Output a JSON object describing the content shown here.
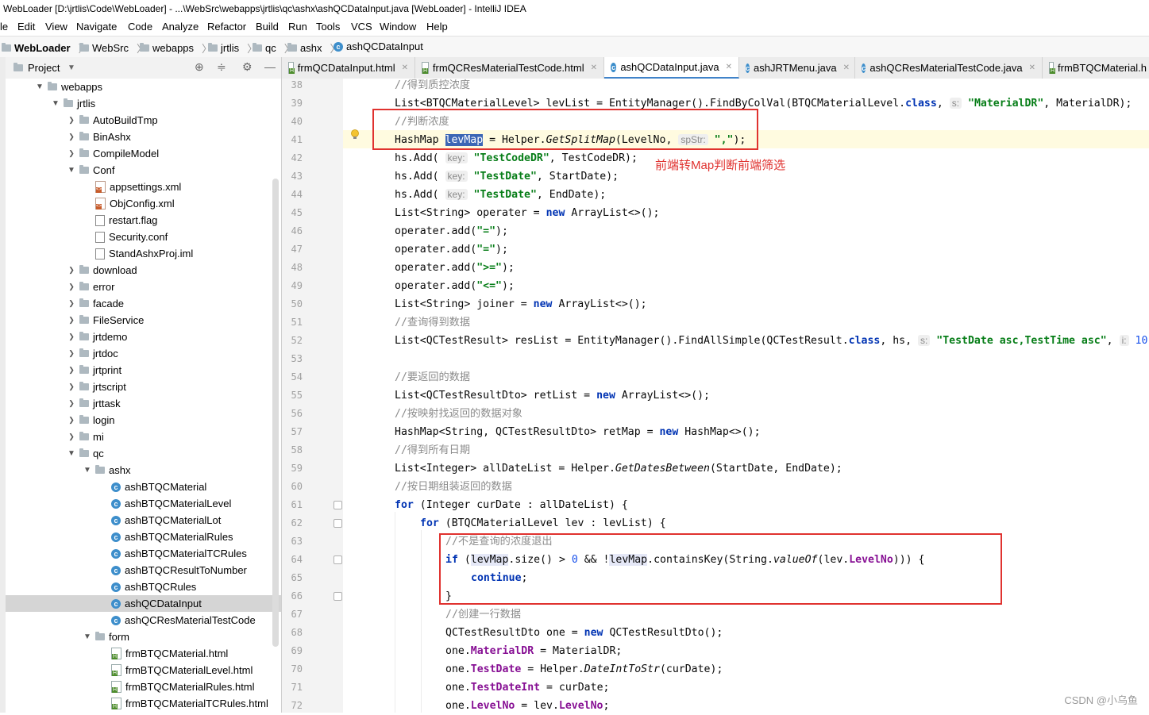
{
  "window": {
    "title": "WebLoader [D:\\jrtlis\\Code\\WebLoader] - ...\\WebSrc\\webapps\\jrtlis\\qc\\ashx\\ashQCDataInput.java [WebLoader] - IntelliJ IDEA"
  },
  "menu": [
    "le",
    "Edit",
    "View",
    "Navigate",
    "Code",
    "Analyze",
    "Refactor",
    "Build",
    "Run",
    "Tools",
    "VCS",
    "Window",
    "Help"
  ],
  "breadcrumb": [
    "WebLoader",
    "WebSrc",
    "webapps",
    "jrtlis",
    "qc",
    "ashx",
    "ashQCDataInput"
  ],
  "project_panel": {
    "title": "Project"
  },
  "tree": [
    {
      "label": "webapps",
      "kind": "folder",
      "depth": 2,
      "expanded": true
    },
    {
      "label": "jrtlis",
      "kind": "folder",
      "depth": 3,
      "expanded": true
    },
    {
      "label": "AutoBuildTmp",
      "kind": "folder",
      "depth": 4
    },
    {
      "label": "BinAshx",
      "kind": "folder",
      "depth": 4
    },
    {
      "label": "CompileModel",
      "kind": "folder",
      "depth": 4
    },
    {
      "label": "Conf",
      "kind": "folder",
      "depth": 4,
      "expanded": true
    },
    {
      "label": "appsettings.xml",
      "kind": "xml",
      "depth": 5
    },
    {
      "label": "ObjConfig.xml",
      "kind": "xml",
      "depth": 5
    },
    {
      "label": "restart.flag",
      "kind": "file",
      "depth": 5
    },
    {
      "label": "Security.conf",
      "kind": "file",
      "depth": 5
    },
    {
      "label": "StandAshxProj.iml",
      "kind": "file",
      "depth": 5
    },
    {
      "label": "download",
      "kind": "folder",
      "depth": 4
    },
    {
      "label": "error",
      "kind": "folder",
      "depth": 4
    },
    {
      "label": "facade",
      "kind": "folder",
      "depth": 4
    },
    {
      "label": "FileService",
      "kind": "folder",
      "depth": 4
    },
    {
      "label": "jrtdemo",
      "kind": "folder",
      "depth": 4
    },
    {
      "label": "jrtdoc",
      "kind": "folder",
      "depth": 4
    },
    {
      "label": "jrtprint",
      "kind": "folder",
      "depth": 4
    },
    {
      "label": "jrtscript",
      "kind": "folder",
      "depth": 4
    },
    {
      "label": "jrttask",
      "kind": "folder",
      "depth": 4
    },
    {
      "label": "login",
      "kind": "folder",
      "depth": 4
    },
    {
      "label": "mi",
      "kind": "folder",
      "depth": 4
    },
    {
      "label": "qc",
      "kind": "folder",
      "depth": 4,
      "expanded": true
    },
    {
      "label": "ashx",
      "kind": "folder",
      "depth": 5,
      "expanded": true
    },
    {
      "label": "ashBTQCMaterial",
      "kind": "class",
      "depth": 6
    },
    {
      "label": "ashBTQCMaterialLevel",
      "kind": "class",
      "depth": 6
    },
    {
      "label": "ashBTQCMaterialLot",
      "kind": "class",
      "depth": 6
    },
    {
      "label": "ashBTQCMaterialRules",
      "kind": "class",
      "depth": 6
    },
    {
      "label": "ashBTQCMaterialTCRules",
      "kind": "class",
      "depth": 6
    },
    {
      "label": "ashBTQCResultToNumber",
      "kind": "class",
      "depth": 6
    },
    {
      "label": "ashBTQCRules",
      "kind": "class",
      "depth": 6
    },
    {
      "label": "ashQCDataInput",
      "kind": "class",
      "depth": 6,
      "selected": true
    },
    {
      "label": "ashQCResMaterialTestCode",
      "kind": "class",
      "depth": 6
    },
    {
      "label": "form",
      "kind": "folder",
      "depth": 5,
      "expanded": true
    },
    {
      "label": "frmBTQCMaterial.html",
      "kind": "html",
      "depth": 6
    },
    {
      "label": "frmBTQCMaterialLevel.html",
      "kind": "html",
      "depth": 6
    },
    {
      "label": "frmBTQCMaterialRules.html",
      "kind": "html",
      "depth": 6
    },
    {
      "label": "frmBTQCMaterialTCRules.html",
      "kind": "html",
      "depth": 6
    }
  ],
  "tabs": [
    {
      "label": "frmQCDataInput.html",
      "kind": "html"
    },
    {
      "label": "frmQCResMaterialTestCode.html",
      "kind": "html"
    },
    {
      "label": "ashQCDataInput.java",
      "kind": "class",
      "active": true
    },
    {
      "label": "ashJRTMenu.java",
      "kind": "class"
    },
    {
      "label": "ashQCResMaterialTestCode.java",
      "kind": "class"
    },
    {
      "label": "frmBTQCMaterial.h",
      "kind": "html"
    }
  ],
  "code": [
    {
      "n": "38",
      "indent": 0,
      "tokens": [
        {
          "t": "//得到质控浓度",
          "c": "cm"
        }
      ]
    },
    {
      "n": "39",
      "indent": 0,
      "tokens": [
        {
          "t": "List<BTQCMaterialLevel> levList = EntityManager().FindByColVal(BTQCMaterialLevel."
        },
        {
          "t": "class",
          "c": "kw"
        },
        {
          "t": ", "
        },
        {
          "t": "s:",
          "c": "hint"
        },
        {
          "t": " "
        },
        {
          "t": "\"MaterialDR\"",
          "c": "str"
        },
        {
          "t": ", MaterialDR);"
        }
      ]
    },
    {
      "n": "40",
      "indent": 0,
      "tokens": [
        {
          "t": "//判断浓度",
          "c": "cm"
        }
      ]
    },
    {
      "n": "41",
      "indent": 0,
      "tokens": [
        {
          "t": "HashMap "
        },
        {
          "t": "levMap",
          "c": "hl"
        },
        {
          "t": " = Helper."
        },
        {
          "t": "GetSplitMap",
          "c": "it"
        },
        {
          "t": "(LevelNo, "
        },
        {
          "t": "spStr:",
          "c": "hint"
        },
        {
          "t": " "
        },
        {
          "t": "\",\"",
          "c": "str"
        },
        {
          "t": ");"
        }
      ]
    },
    {
      "n": "42",
      "indent": 0,
      "tokens": [
        {
          "t": "hs.Add( "
        },
        {
          "t": "key:",
          "c": "hint"
        },
        {
          "t": " "
        },
        {
          "t": "\"TestCodeDR\"",
          "c": "str"
        },
        {
          "t": ", TestCodeDR);"
        }
      ]
    },
    {
      "n": "43",
      "indent": 0,
      "tokens": [
        {
          "t": "hs.Add( "
        },
        {
          "t": "key:",
          "c": "hint"
        },
        {
          "t": " "
        },
        {
          "t": "\"TestDate\"",
          "c": "str"
        },
        {
          "t": ", StartDate);"
        }
      ]
    },
    {
      "n": "44",
      "indent": 0,
      "tokens": [
        {
          "t": "hs.Add( "
        },
        {
          "t": "key:",
          "c": "hint"
        },
        {
          "t": " "
        },
        {
          "t": "\"TestDate\"",
          "c": "str"
        },
        {
          "t": ", EndDate);"
        }
      ]
    },
    {
      "n": "45",
      "indent": 0,
      "tokens": [
        {
          "t": "List<String> operater = "
        },
        {
          "t": "new",
          "c": "kw"
        },
        {
          "t": " ArrayList<>();"
        }
      ]
    },
    {
      "n": "46",
      "indent": 0,
      "tokens": [
        {
          "t": "operater.add("
        },
        {
          "t": "\"=\"",
          "c": "str"
        },
        {
          "t": ");"
        }
      ]
    },
    {
      "n": "47",
      "indent": 0,
      "tokens": [
        {
          "t": "operater.add("
        },
        {
          "t": "\"=\"",
          "c": "str"
        },
        {
          "t": ");"
        }
      ]
    },
    {
      "n": "48",
      "indent": 0,
      "tokens": [
        {
          "t": "operater.add("
        },
        {
          "t": "\">=\"",
          "c": "str"
        },
        {
          "t": ");"
        }
      ]
    },
    {
      "n": "49",
      "indent": 0,
      "tokens": [
        {
          "t": "operater.add("
        },
        {
          "t": "\"<=\"",
          "c": "str"
        },
        {
          "t": ");"
        }
      ]
    },
    {
      "n": "50",
      "indent": 0,
      "tokens": [
        {
          "t": "List<String> joiner = "
        },
        {
          "t": "new",
          "c": "kw"
        },
        {
          "t": " ArrayList<>();"
        }
      ]
    },
    {
      "n": "51",
      "indent": 0,
      "tokens": [
        {
          "t": "//查询得到数据",
          "c": "cm"
        }
      ]
    },
    {
      "n": "52",
      "indent": 0,
      "tokens": [
        {
          "t": "List<QCTestResult> resList = EntityManager().FindAllSimple(QCTestResult."
        },
        {
          "t": "class",
          "c": "kw"
        },
        {
          "t": ", hs, "
        },
        {
          "t": "s:",
          "c": "hint"
        },
        {
          "t": " "
        },
        {
          "t": "\"TestDate asc,TestTime asc\"",
          "c": "str"
        },
        {
          "t": ", "
        },
        {
          "t": "i:",
          "c": "hint"
        },
        {
          "t": " "
        },
        {
          "t": "10",
          "c": "num"
        }
      ]
    },
    {
      "n": "53",
      "indent": 0,
      "tokens": []
    },
    {
      "n": "54",
      "indent": 0,
      "tokens": [
        {
          "t": "//要返回的数据",
          "c": "cm"
        }
      ]
    },
    {
      "n": "55",
      "indent": 0,
      "tokens": [
        {
          "t": "List<QCTestResultDto> retList = "
        },
        {
          "t": "new",
          "c": "kw"
        },
        {
          "t": " ArrayList<>();"
        }
      ]
    },
    {
      "n": "56",
      "indent": 0,
      "tokens": [
        {
          "t": "//按映射找返回的数据对象",
          "c": "cm"
        }
      ]
    },
    {
      "n": "57",
      "indent": 0,
      "tokens": [
        {
          "t": "HashMap<String, QCTestResultDto> retMap = "
        },
        {
          "t": "new",
          "c": "kw"
        },
        {
          "t": " HashMap<>();"
        }
      ]
    },
    {
      "n": "58",
      "indent": 0,
      "tokens": [
        {
          "t": "//得到所有日期",
          "c": "cm"
        }
      ]
    },
    {
      "n": "59",
      "indent": 0,
      "tokens": [
        {
          "t": "List<Integer> allDateList = Helper."
        },
        {
          "t": "GetDatesBetween",
          "c": "it"
        },
        {
          "t": "(StartDate, EndDate);"
        }
      ]
    },
    {
      "n": "60",
      "indent": 0,
      "tokens": [
        {
          "t": "//按日期组装返回的数据",
          "c": "cm"
        }
      ]
    },
    {
      "n": "61",
      "indent": 0,
      "tokens": [
        {
          "t": "for",
          "c": "kw"
        },
        {
          "t": " (Integer curDate : allDateList) {"
        }
      ]
    },
    {
      "n": "62",
      "indent": 1,
      "tokens": [
        {
          "t": "for",
          "c": "kw"
        },
        {
          "t": " (BTQCMaterialLevel lev : levList) {"
        }
      ]
    },
    {
      "n": "63",
      "indent": 2,
      "tokens": [
        {
          "t": "//不是查询的浓度退出",
          "c": "cm"
        }
      ]
    },
    {
      "n": "64",
      "indent": 2,
      "tokens": [
        {
          "t": "if",
          "c": "kw"
        },
        {
          "t": " ("
        },
        {
          "t": "levMap",
          "c": "rng"
        },
        {
          "t": ".size() > "
        },
        {
          "t": "0",
          "c": "num"
        },
        {
          "t": " && !"
        },
        {
          "t": "levMap",
          "c": "rng"
        },
        {
          "t": ".containsKey(String."
        },
        {
          "t": "valueOf",
          "c": "it"
        },
        {
          "t": "(lev."
        },
        {
          "t": "LevelNo",
          "c": "fld"
        },
        {
          "t": "))) {"
        }
      ]
    },
    {
      "n": "65",
      "indent": 3,
      "tokens": [
        {
          "t": "continue",
          "c": "kw"
        },
        {
          "t": ";"
        }
      ]
    },
    {
      "n": "66",
      "indent": 2,
      "tokens": [
        {
          "t": "}"
        }
      ]
    },
    {
      "n": "67",
      "indent": 2,
      "tokens": [
        {
          "t": "//创建一行数据",
          "c": "cm"
        }
      ]
    },
    {
      "n": "68",
      "indent": 2,
      "tokens": [
        {
          "t": "QCTestResultDto one = "
        },
        {
          "t": "new",
          "c": "kw"
        },
        {
          "t": " QCTestResultDto();"
        }
      ]
    },
    {
      "n": "69",
      "indent": 2,
      "tokens": [
        {
          "t": "one."
        },
        {
          "t": "MaterialDR",
          "c": "fld"
        },
        {
          "t": " = MaterialDR;"
        }
      ]
    },
    {
      "n": "70",
      "indent": 2,
      "tokens": [
        {
          "t": "one."
        },
        {
          "t": "TestDate",
          "c": "fld"
        },
        {
          "t": " = Helper."
        },
        {
          "t": "DateIntToStr",
          "c": "it"
        },
        {
          "t": "(curDate);"
        }
      ]
    },
    {
      "n": "71",
      "indent": 2,
      "tokens": [
        {
          "t": "one."
        },
        {
          "t": "TestDateInt",
          "c": "fld"
        },
        {
          "t": " = curDate;"
        }
      ]
    },
    {
      "n": "72",
      "indent": 2,
      "tokens": [
        {
          "t": "one."
        },
        {
          "t": "LevelNo",
          "c": "fld"
        },
        {
          "t": " = lev."
        },
        {
          "t": "LevelNo",
          "c": "fld"
        },
        {
          "t": ";"
        }
      ]
    }
  ],
  "annotation": {
    "text": "前端转Map判断前端筛选"
  },
  "watermark": {
    "text": "CSDN @小乌鱼"
  },
  "colors": {
    "annotation_red": "#e0322f",
    "selection_blue": "#3c66b5",
    "keyword": "#0033b3",
    "string": "#067d17"
  }
}
